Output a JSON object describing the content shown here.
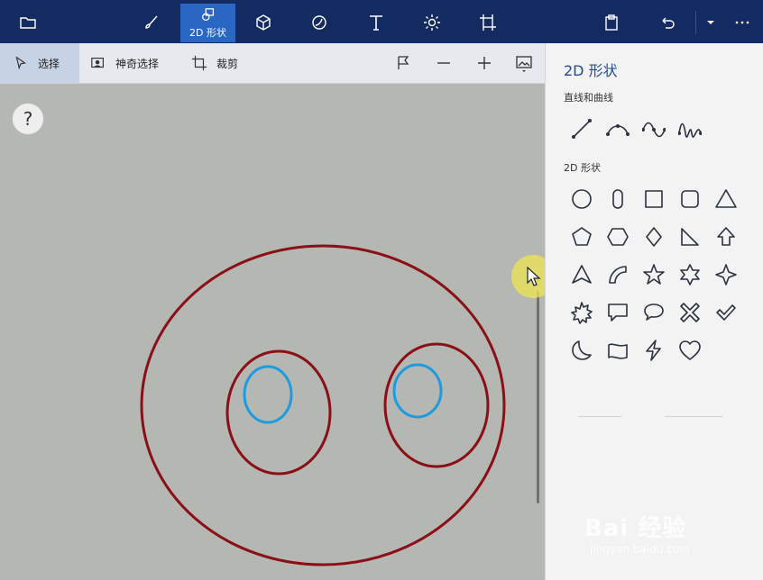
{
  "topbar": {
    "tabs": [
      {
        "name": "folder"
      },
      {
        "name": "brushes"
      },
      {
        "name": "2d-shapes",
        "label": "2D 形状",
        "active": true
      },
      {
        "name": "3d-shapes"
      },
      {
        "name": "stickers"
      },
      {
        "name": "text"
      },
      {
        "name": "effects"
      },
      {
        "name": "canvas"
      }
    ],
    "accent": "#2a66c3",
    "background": "#142b61"
  },
  "toolbar": {
    "select_label": "选择",
    "magic_select_label": "神奇选择",
    "crop_label": "裁剪"
  },
  "canvas": {
    "help_label": "?",
    "outline_color": "#8b0f17",
    "eye_color": "#1e9be0",
    "background": "#b4b7b2"
  },
  "panel": {
    "title": "2D 形状",
    "lines_section": "直线和曲线",
    "shapes_section": "2D 形状",
    "lines": [
      "line",
      "curve",
      "curve-2",
      "curve-3"
    ],
    "shapes": [
      "circle",
      "rounded-rect-vertical",
      "square",
      "rounded-square",
      "triangle",
      "pentagon",
      "hexagon",
      "diamond",
      "right-triangle",
      "arrow-up",
      "triangle-concave",
      "quarter-circle",
      "star-5",
      "star-6",
      "star-4",
      "burst",
      "speech-rect",
      "speech-round",
      "x-mark",
      "check-mark",
      "moon",
      "wave-flag",
      "lightning",
      "heart"
    ]
  },
  "watermark": {
    "main": "Bai 经验",
    "sub": "jingyan.baidu.com"
  }
}
